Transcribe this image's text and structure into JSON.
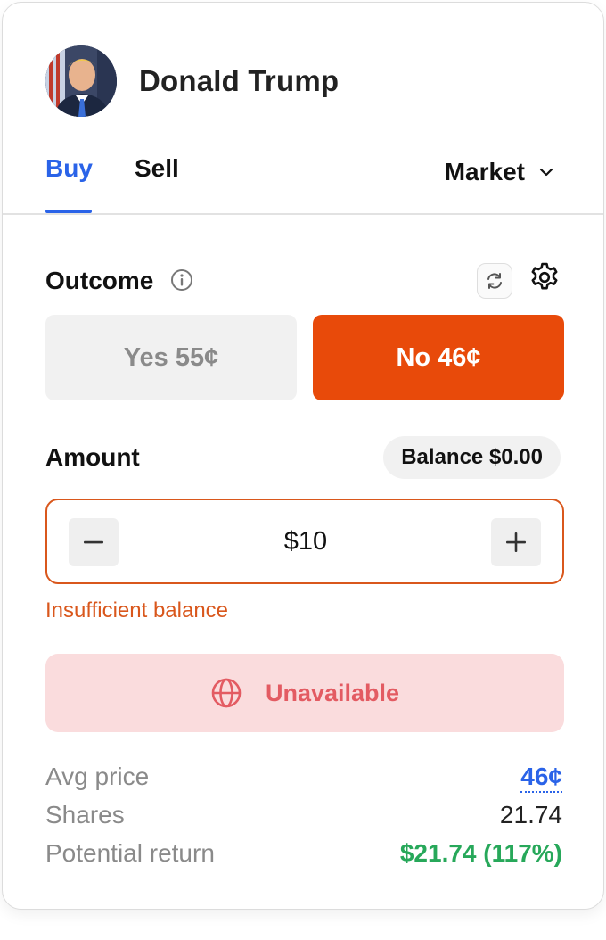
{
  "market": {
    "name": "Donald Trump"
  },
  "tabs": {
    "buy": "Buy",
    "sell": "Sell",
    "order_type": "Market"
  },
  "outcome": {
    "label": "Outcome",
    "yes_label": "Yes 55¢",
    "no_label": "No 46¢",
    "selected": "No"
  },
  "amount": {
    "label": "Amount",
    "balance": "Balance $0.00",
    "value": "$10",
    "error": "Insufficient balance"
  },
  "submit": {
    "label": "Unavailable"
  },
  "summary": {
    "avg_price_label": "Avg price",
    "avg_price": "46¢",
    "shares_label": "Shares",
    "shares": "21.74",
    "return_label": "Potential return",
    "return": "$21.74 (117%)"
  },
  "icons": {
    "info": "info-icon",
    "refresh": "refresh-icon",
    "settings": "gear-icon",
    "dropdown": "chevron-down-icon",
    "minus": "minus-icon",
    "plus": "plus-icon",
    "globe": "globe-icon"
  },
  "colors": {
    "accent_blue": "#2a63e8",
    "no_orange": "#e84a0a",
    "error": "#d9571c",
    "unavailable_bg": "#fadcdd",
    "unavailable_text": "#e35b62",
    "return_green": "#27a85a"
  }
}
